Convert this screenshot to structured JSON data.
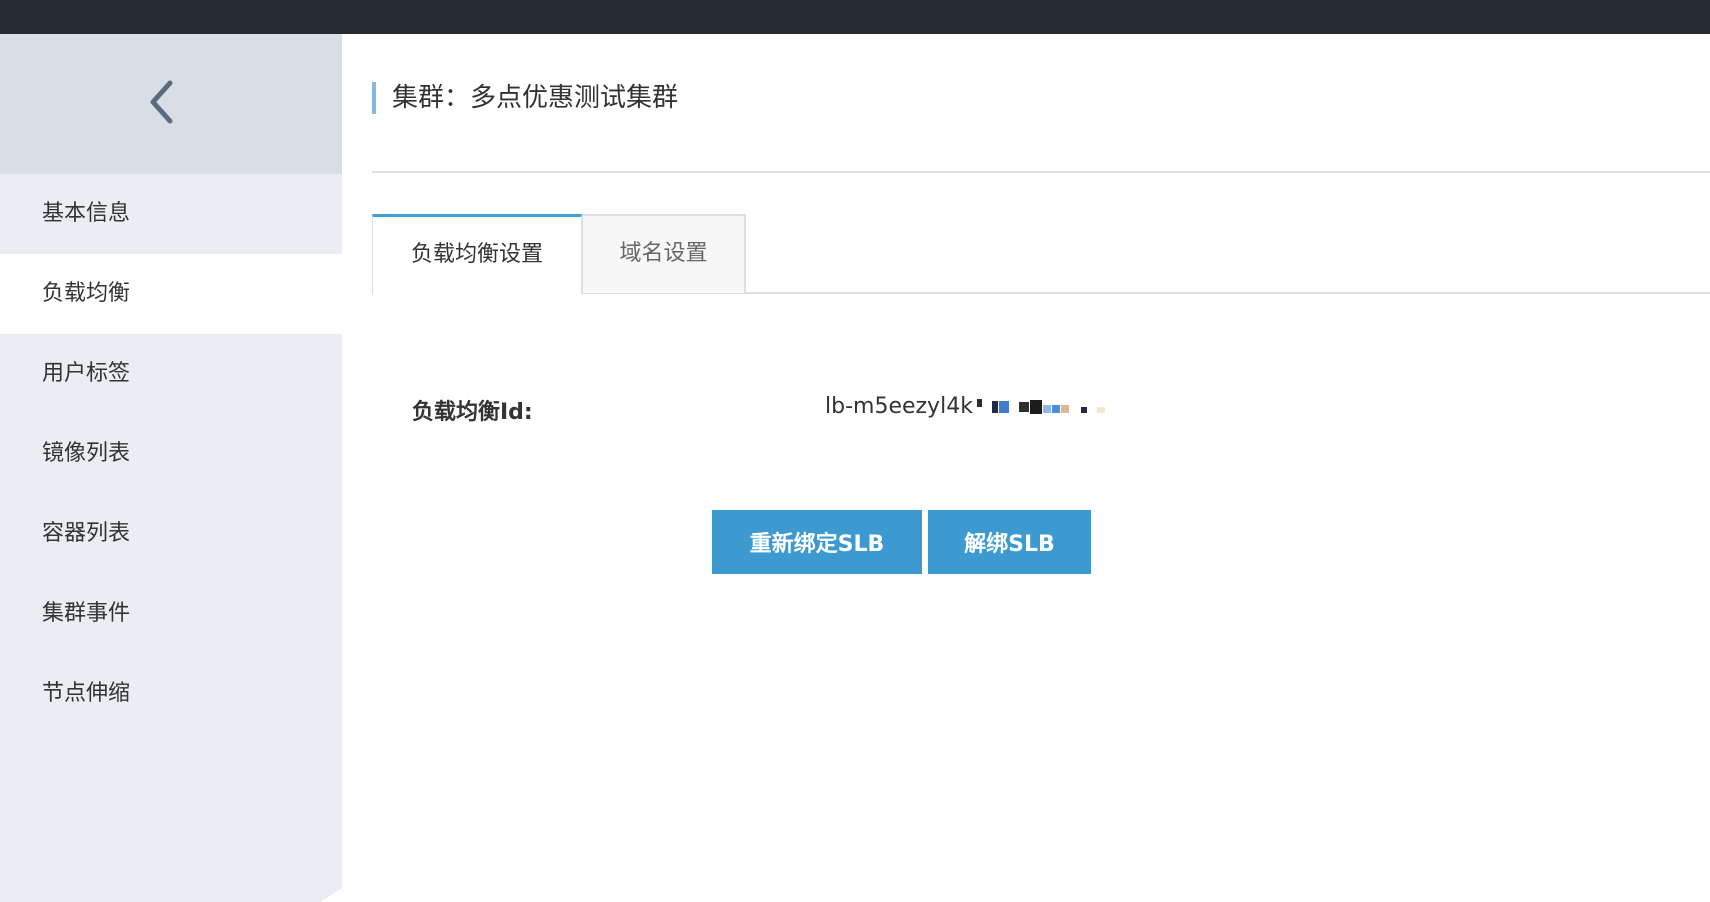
{
  "sidebar": {
    "back_icon": "chevron-left-icon",
    "items": [
      {
        "label": "基本信息",
        "active": false
      },
      {
        "label": "负载均衡",
        "active": true
      },
      {
        "label": "用户标签",
        "active": false
      },
      {
        "label": "镜像列表",
        "active": false
      },
      {
        "label": "容器列表",
        "active": false
      },
      {
        "label": "集群事件",
        "active": false
      },
      {
        "label": "节点伸缩",
        "active": false
      }
    ]
  },
  "header": {
    "title": "集群：多点优惠测试集群"
  },
  "tabs": [
    {
      "label": "负载均衡设置",
      "active": true
    },
    {
      "label": "域名设置",
      "active": false
    }
  ],
  "lb": {
    "id_label": "负载均衡Id:",
    "id_value": "lb-m5eezyl4k"
  },
  "actions": {
    "rebind_label": "重新绑定SLB",
    "unbind_label": "解绑SLB"
  },
  "colors": {
    "topbar": "#262a31",
    "sidebar_bg": "#eaedf1",
    "accent": "#3c9ad0",
    "title_marker": "#88b7e0"
  }
}
